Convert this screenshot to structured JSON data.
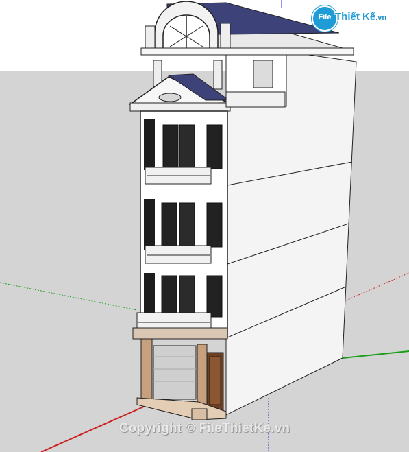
{
  "watermark": {
    "logo_badge": "File",
    "logo_brand": "Thiết Kế",
    "logo_domain": ".vn",
    "copyright": "Copyright © FileThietKe.vn"
  },
  "scene": {
    "sky_color": "#ffffff",
    "ground_color": "#d4d4d4",
    "axis_colors": {
      "red": "#cc2020",
      "green": "#1b9e1b",
      "blue": "#2b2bd6"
    }
  }
}
